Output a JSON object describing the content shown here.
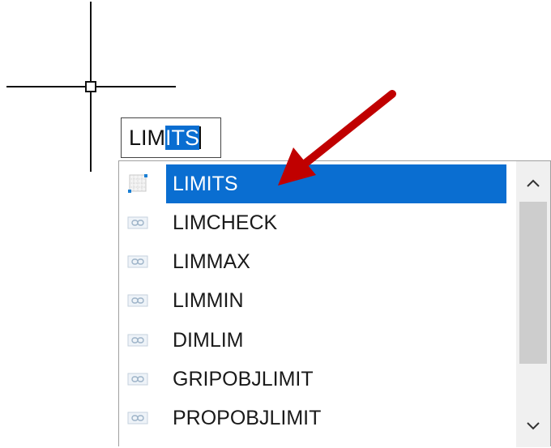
{
  "command_input": {
    "typed": "LIM",
    "autocomplete": "ITS"
  },
  "autocomplete_list": {
    "items": [
      {
        "label": "LIMITS",
        "icon": "grid-limits-icon",
        "selected": true
      },
      {
        "label": "LIMCHECK",
        "icon": "system-variable-icon",
        "selected": false
      },
      {
        "label": "LIMMAX",
        "icon": "system-variable-icon",
        "selected": false
      },
      {
        "label": "LIMMIN",
        "icon": "system-variable-icon",
        "selected": false
      },
      {
        "label": "DIMLIM",
        "icon": "system-variable-icon",
        "selected": false
      },
      {
        "label": "GRIPOBJLIMIT",
        "icon": "system-variable-icon",
        "selected": false
      },
      {
        "label": "PROPOBJLIMIT",
        "icon": "system-variable-icon",
        "selected": false
      }
    ]
  },
  "colors": {
    "selection": "#0a6ed1",
    "annotation_arrow": "#c00000"
  }
}
